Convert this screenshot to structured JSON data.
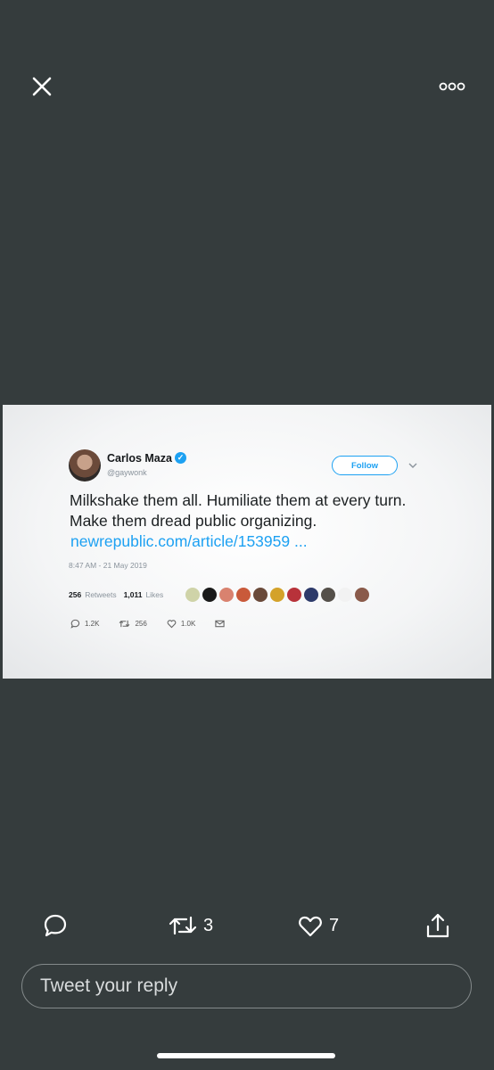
{
  "viewer": {
    "close_icon": "close-icon",
    "more_icon": "more-options-icon"
  },
  "media": {
    "author_name": "Carlos Maza",
    "author_handle": "@gaywonk",
    "verified_mark": "✓",
    "follow_label": "Follow",
    "tweet_text": "Milkshake them all. Humiliate them at every turn. Make them dread public organizing.",
    "tweet_link": "newrepublic.com/article/153959 ...",
    "timestamp": "8:47 AM - 21 May 2019",
    "retweets_count": "256",
    "retweets_label": "Retweets",
    "likes_count": "1,011",
    "likes_label": "Likes",
    "reply_count": "1.2K",
    "retweet_count_small": "256",
    "like_count_small": "1.0K",
    "colors": {
      "link": "#1da1f2",
      "background": "#353c3d"
    }
  },
  "actions": {
    "reply_icon": "reply-icon",
    "retweet_count": "3",
    "like_count": "7",
    "share_icon": "share-icon"
  },
  "reply": {
    "placeholder": "Tweet your reply"
  }
}
